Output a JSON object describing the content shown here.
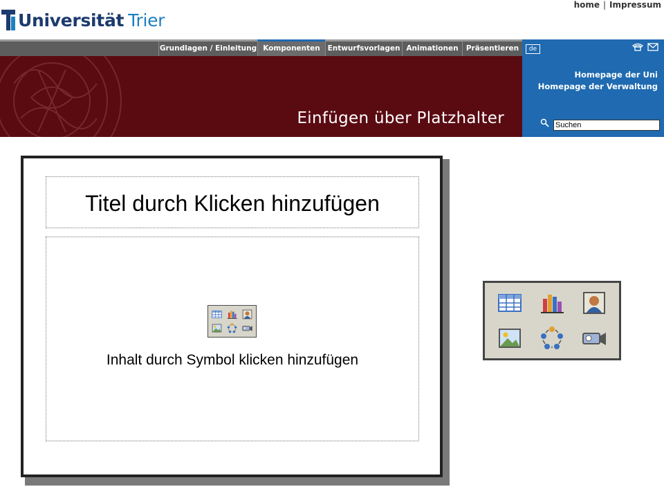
{
  "header": {
    "logo": {
      "bold": "Universität",
      "light": "Trier"
    },
    "links": {
      "home": "home",
      "separator": "|",
      "impressum": "Impressum"
    }
  },
  "nav": {
    "tabs": [
      {
        "label": "Grundlagen / Einleitung"
      },
      {
        "label": "Komponenten",
        "active": true
      },
      {
        "label": "Entwurfsvorlagen"
      },
      {
        "label": "Animationen"
      },
      {
        "label": "Präsentieren"
      }
    ]
  },
  "banner": {
    "title": "Einfügen über Platzhalter"
  },
  "sidepanel": {
    "lang": "de",
    "links": [
      "Homepage der Uni",
      "Homepage der Verwaltung"
    ],
    "search": {
      "value": "Suchen"
    }
  },
  "slide": {
    "title_placeholder": "Titel durch Klicken hinzufügen",
    "content_placeholder": "Inhalt durch Symbol klicken hinzufügen"
  },
  "palette_icons": [
    "table-icon",
    "chart-icon",
    "clipart-icon",
    "picture-icon",
    "smartart-icon",
    "media-clip-icon"
  ],
  "colors": {
    "banner": "#5a0b12",
    "nav": "#5d5d5d",
    "side_panel": "#1f6ab0",
    "logo_dark": "#1c3b6e",
    "logo_light": "#1c7fc0"
  }
}
